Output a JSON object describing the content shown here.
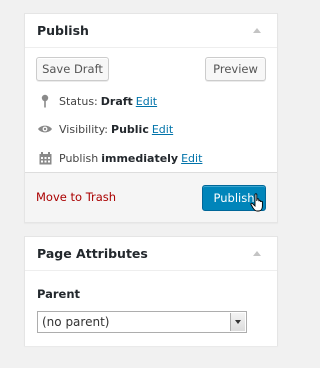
{
  "publish_box": {
    "title": "Publish",
    "save_draft_label": "Save Draft",
    "preview_label": "Preview",
    "status": {
      "label": "Status:",
      "value": "Draft",
      "edit": "Edit",
      "icon": "pin-icon"
    },
    "visibility": {
      "label": "Visibility:",
      "value": "Public",
      "edit": "Edit",
      "icon": "eye-icon"
    },
    "schedule": {
      "label": "Publish",
      "value": "immediately",
      "edit": "Edit",
      "icon": "calendar-icon"
    },
    "trash_label": "Move to Trash",
    "publish_label": "Publish"
  },
  "attributes_box": {
    "title": "Page Attributes",
    "parent_label": "Parent",
    "parent_value": "(no parent)"
  },
  "colors": {
    "link": "#0073aa",
    "trash": "#aa0000",
    "primary": "#0085ba",
    "background": "#f1f1f1"
  }
}
